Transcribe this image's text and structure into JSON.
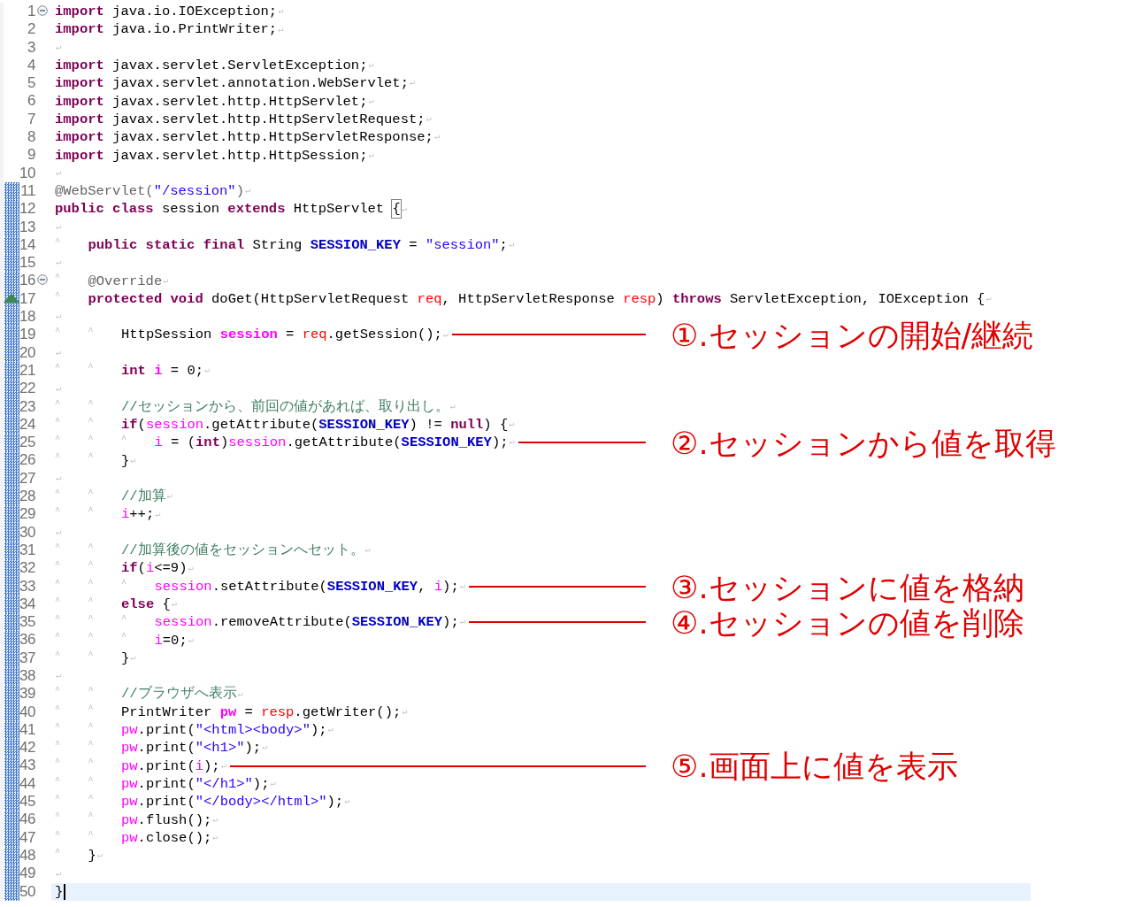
{
  "editor": {
    "lines": [
      {
        "number": "1",
        "collapsible": true,
        "overrides": false,
        "changed": false,
        "current": false,
        "tokens": [
          {
            "kind": "kw",
            "text": "import"
          },
          {
            "kind": "pl",
            "text": " java.io.IOException;"
          },
          {
            "kind": "eol",
            "text": "↵"
          }
        ]
      },
      {
        "number": "2",
        "collapsible": false,
        "overrides": false,
        "changed": false,
        "current": false,
        "tokens": [
          {
            "kind": "kw",
            "text": "import"
          },
          {
            "kind": "pl",
            "text": " java.io.PrintWriter;"
          },
          {
            "kind": "eol",
            "text": "↵"
          }
        ]
      },
      {
        "number": "3",
        "collapsible": false,
        "overrides": false,
        "changed": false,
        "current": false,
        "tokens": [
          {
            "kind": "eol",
            "text": "↵"
          }
        ]
      },
      {
        "number": "4",
        "collapsible": false,
        "overrides": false,
        "changed": false,
        "current": false,
        "tokens": [
          {
            "kind": "kw",
            "text": "import"
          },
          {
            "kind": "pl",
            "text": " javax.servlet.ServletException;"
          },
          {
            "kind": "eol",
            "text": "↵"
          }
        ]
      },
      {
        "number": "5",
        "collapsible": false,
        "overrides": false,
        "changed": false,
        "current": false,
        "tokens": [
          {
            "kind": "kw",
            "text": "import"
          },
          {
            "kind": "pl",
            "text": " javax.servlet.annotation.WebServlet;"
          },
          {
            "kind": "eol",
            "text": "↵"
          }
        ]
      },
      {
        "number": "6",
        "collapsible": false,
        "overrides": false,
        "changed": false,
        "current": false,
        "tokens": [
          {
            "kind": "kw",
            "text": "import"
          },
          {
            "kind": "pl",
            "text": " javax.servlet.http.HttpServlet;"
          },
          {
            "kind": "eol",
            "text": "↵"
          }
        ]
      },
      {
        "number": "7",
        "collapsible": false,
        "overrides": false,
        "changed": false,
        "current": false,
        "tokens": [
          {
            "kind": "kw",
            "text": "import"
          },
          {
            "kind": "pl",
            "text": " javax.servlet.http.HttpServletRequest;"
          },
          {
            "kind": "eol",
            "text": "↵"
          }
        ]
      },
      {
        "number": "8",
        "collapsible": false,
        "overrides": false,
        "changed": false,
        "current": false,
        "tokens": [
          {
            "kind": "kw",
            "text": "import"
          },
          {
            "kind": "pl",
            "text": " javax.servlet.http.HttpServletResponse;"
          },
          {
            "kind": "eol",
            "text": "↵"
          }
        ]
      },
      {
        "number": "9",
        "collapsible": false,
        "overrides": false,
        "changed": false,
        "current": false,
        "tokens": [
          {
            "kind": "kw",
            "text": "import"
          },
          {
            "kind": "pl",
            "text": " javax.servlet.http.HttpSession;"
          },
          {
            "kind": "eol",
            "text": "↵"
          }
        ]
      },
      {
        "number": "10",
        "collapsible": false,
        "overrides": false,
        "changed": false,
        "current": false,
        "tokens": [
          {
            "kind": "eol",
            "text": "↵"
          }
        ]
      },
      {
        "number": "11",
        "collapsible": false,
        "overrides": false,
        "changed": true,
        "current": false,
        "tokens": [
          {
            "kind": "anno",
            "text": "@WebServlet("
          },
          {
            "kind": "str",
            "text": "\"/session\""
          },
          {
            "kind": "anno",
            "text": ")"
          },
          {
            "kind": "eol",
            "text": "↵"
          }
        ]
      },
      {
        "number": "12",
        "collapsible": false,
        "overrides": false,
        "changed": true,
        "current": false,
        "tokens": [
          {
            "kind": "kw",
            "text": "public class"
          },
          {
            "kind": "pl",
            "text": " session "
          },
          {
            "kind": "kw",
            "text": "extends"
          },
          {
            "kind": "pl",
            "text": " HttpServlet "
          },
          {
            "kind": "match",
            "text": "{"
          },
          {
            "kind": "eol",
            "text": "↵"
          }
        ]
      },
      {
        "number": "13",
        "collapsible": false,
        "overrides": false,
        "changed": true,
        "current": false,
        "tokens": [
          {
            "kind": "eol",
            "text": "↵"
          }
        ]
      },
      {
        "number": "14",
        "collapsible": false,
        "overrides": false,
        "changed": true,
        "current": false,
        "tokens": [
          {
            "kind": "tab",
            "text": "^"
          },
          {
            "kind": "kw",
            "text": "public static final"
          },
          {
            "kind": "pl",
            "text": " String "
          },
          {
            "kind": "const",
            "text": "SESSION_KEY"
          },
          {
            "kind": "pl",
            "text": " = "
          },
          {
            "kind": "str",
            "text": "\"session\""
          },
          {
            "kind": "pl",
            "text": ";"
          },
          {
            "kind": "eol",
            "text": "↵"
          }
        ]
      },
      {
        "number": "15",
        "collapsible": false,
        "overrides": false,
        "changed": true,
        "current": false,
        "tokens": [
          {
            "kind": "eol",
            "text": "↵"
          }
        ]
      },
      {
        "number": "16",
        "collapsible": true,
        "overrides": false,
        "changed": true,
        "current": false,
        "tokens": [
          {
            "kind": "tab",
            "text": "^"
          },
          {
            "kind": "anno",
            "text": "@Override"
          },
          {
            "kind": "eol",
            "text": "↵"
          }
        ]
      },
      {
        "number": "17",
        "collapsible": false,
        "overrides": true,
        "changed": true,
        "current": false,
        "tokens": [
          {
            "kind": "tab",
            "text": "^"
          },
          {
            "kind": "kw",
            "text": "protected void"
          },
          {
            "kind": "pl",
            "text": " doGet(HttpServletRequest "
          },
          {
            "kind": "param",
            "text": "req"
          },
          {
            "kind": "pl",
            "text": ", HttpServletResponse "
          },
          {
            "kind": "param",
            "text": "resp"
          },
          {
            "kind": "pl",
            "text": ") "
          },
          {
            "kind": "kw",
            "text": "throws"
          },
          {
            "kind": "pl",
            "text": " ServletException, IOException {"
          },
          {
            "kind": "eol",
            "text": "↵"
          }
        ]
      },
      {
        "number": "18",
        "collapsible": false,
        "overrides": false,
        "changed": true,
        "current": false,
        "tokens": [
          {
            "kind": "eol",
            "text": "↵"
          }
        ]
      },
      {
        "number": "19",
        "collapsible": false,
        "overrides": false,
        "changed": true,
        "current": false,
        "note": "①.セッションの開始/継続",
        "tokens": [
          {
            "kind": "tab",
            "text": "^"
          },
          {
            "kind": "tab",
            "text": "^"
          },
          {
            "kind": "pl",
            "text": "HttpSession "
          },
          {
            "kind": "localb",
            "text": "session"
          },
          {
            "kind": "pl",
            "text": " = "
          },
          {
            "kind": "param",
            "text": "req"
          },
          {
            "kind": "pl",
            "text": ".getSession();"
          },
          {
            "kind": "eol",
            "text": "↵"
          }
        ]
      },
      {
        "number": "20",
        "collapsible": false,
        "overrides": false,
        "changed": true,
        "current": false,
        "tokens": [
          {
            "kind": "eol",
            "text": "↵"
          }
        ]
      },
      {
        "number": "21",
        "collapsible": false,
        "overrides": false,
        "changed": true,
        "current": false,
        "tokens": [
          {
            "kind": "tab",
            "text": "^"
          },
          {
            "kind": "tab",
            "text": "^"
          },
          {
            "kind": "kw",
            "text": "int "
          },
          {
            "kind": "localb",
            "text": "i"
          },
          {
            "kind": "pl",
            "text": " = 0;"
          },
          {
            "kind": "eol",
            "text": "↵"
          }
        ]
      },
      {
        "number": "22",
        "collapsible": false,
        "overrides": false,
        "changed": true,
        "current": false,
        "tokens": [
          {
            "kind": "eol",
            "text": "↵"
          }
        ]
      },
      {
        "number": "23",
        "collapsible": false,
        "overrides": false,
        "changed": true,
        "current": false,
        "tokens": [
          {
            "kind": "tab",
            "text": "^"
          },
          {
            "kind": "tab",
            "text": "^"
          },
          {
            "kind": "comment",
            "text": "//セッションから、前回の値があれば、取り出し。"
          },
          {
            "kind": "eol",
            "text": "↵"
          }
        ]
      },
      {
        "number": "24",
        "collapsible": false,
        "overrides": false,
        "changed": true,
        "current": false,
        "tokens": [
          {
            "kind": "tab",
            "text": "^"
          },
          {
            "kind": "tab",
            "text": "^"
          },
          {
            "kind": "kw",
            "text": "if"
          },
          {
            "kind": "pl",
            "text": "("
          },
          {
            "kind": "local",
            "text": "session"
          },
          {
            "kind": "pl",
            "text": ".getAttribute("
          },
          {
            "kind": "const",
            "text": "SESSION_KEY"
          },
          {
            "kind": "pl",
            "text": ") != "
          },
          {
            "kind": "kw",
            "text": "null"
          },
          {
            "kind": "pl",
            "text": ") {"
          },
          {
            "kind": "eol",
            "text": "↵"
          }
        ]
      },
      {
        "number": "25",
        "collapsible": false,
        "overrides": false,
        "changed": true,
        "current": false,
        "note": "②.セッションから値を取得",
        "tokens": [
          {
            "kind": "tab",
            "text": "^"
          },
          {
            "kind": "tab",
            "text": "^"
          },
          {
            "kind": "tab",
            "text": "^"
          },
          {
            "kind": "local",
            "text": "i"
          },
          {
            "kind": "pl",
            "text": " = ("
          },
          {
            "kind": "kw",
            "text": "int"
          },
          {
            "kind": "pl",
            "text": ")"
          },
          {
            "kind": "local",
            "text": "session"
          },
          {
            "kind": "pl",
            "text": ".getAttribute("
          },
          {
            "kind": "const",
            "text": "SESSION_KEY"
          },
          {
            "kind": "pl",
            "text": ");"
          },
          {
            "kind": "eol",
            "text": "↵"
          }
        ]
      },
      {
        "number": "26",
        "collapsible": false,
        "overrides": false,
        "changed": true,
        "current": false,
        "tokens": [
          {
            "kind": "tab",
            "text": "^"
          },
          {
            "kind": "tab",
            "text": "^"
          },
          {
            "kind": "pl",
            "text": "}"
          },
          {
            "kind": "eol",
            "text": "↵"
          }
        ]
      },
      {
        "number": "27",
        "collapsible": false,
        "overrides": false,
        "changed": true,
        "current": false,
        "tokens": [
          {
            "kind": "eol",
            "text": "↵"
          }
        ]
      },
      {
        "number": "28",
        "collapsible": false,
        "overrides": false,
        "changed": true,
        "current": false,
        "tokens": [
          {
            "kind": "tab",
            "text": "^"
          },
          {
            "kind": "tab",
            "text": "^"
          },
          {
            "kind": "comment",
            "text": "//加算"
          },
          {
            "kind": "eol",
            "text": "↵"
          }
        ]
      },
      {
        "number": "29",
        "collapsible": false,
        "overrides": false,
        "changed": true,
        "current": false,
        "tokens": [
          {
            "kind": "tab",
            "text": "^"
          },
          {
            "kind": "tab",
            "text": "^"
          },
          {
            "kind": "local",
            "text": "i"
          },
          {
            "kind": "pl",
            "text": "++;"
          },
          {
            "kind": "eol",
            "text": "↵"
          }
        ]
      },
      {
        "number": "30",
        "collapsible": false,
        "overrides": false,
        "changed": true,
        "current": false,
        "tokens": [
          {
            "kind": "eol",
            "text": "↵"
          }
        ]
      },
      {
        "number": "31",
        "collapsible": false,
        "overrides": false,
        "changed": true,
        "current": false,
        "tokens": [
          {
            "kind": "tab",
            "text": "^"
          },
          {
            "kind": "tab",
            "text": "^"
          },
          {
            "kind": "comment",
            "text": "//加算後の値をセッションへセット。"
          },
          {
            "kind": "eol",
            "text": "↵"
          }
        ]
      },
      {
        "number": "32",
        "collapsible": false,
        "overrides": false,
        "changed": true,
        "current": false,
        "tokens": [
          {
            "kind": "tab",
            "text": "^"
          },
          {
            "kind": "tab",
            "text": "^"
          },
          {
            "kind": "kw",
            "text": "if"
          },
          {
            "kind": "pl",
            "text": "("
          },
          {
            "kind": "local",
            "text": "i"
          },
          {
            "kind": "pl",
            "text": "<=9)"
          },
          {
            "kind": "eol",
            "text": "↵"
          }
        ]
      },
      {
        "number": "33",
        "collapsible": false,
        "overrides": false,
        "changed": true,
        "current": false,
        "note": "③.セッションに値を格納",
        "tokens": [
          {
            "kind": "tab",
            "text": "^"
          },
          {
            "kind": "tab",
            "text": "^"
          },
          {
            "kind": "tab",
            "text": "^"
          },
          {
            "kind": "local",
            "text": "session"
          },
          {
            "kind": "pl",
            "text": ".setAttribute("
          },
          {
            "kind": "const",
            "text": "SESSION_KEY"
          },
          {
            "kind": "pl",
            "text": ", "
          },
          {
            "kind": "local",
            "text": "i"
          },
          {
            "kind": "pl",
            "text": ");"
          },
          {
            "kind": "eol",
            "text": "↵"
          }
        ]
      },
      {
        "number": "34",
        "collapsible": false,
        "overrides": false,
        "changed": true,
        "current": false,
        "tokens": [
          {
            "kind": "tab",
            "text": "^"
          },
          {
            "kind": "tab",
            "text": "^"
          },
          {
            "kind": "kw",
            "text": "else"
          },
          {
            "kind": "pl",
            "text": " {"
          },
          {
            "kind": "eol",
            "text": "↵"
          }
        ]
      },
      {
        "number": "35",
        "collapsible": false,
        "overrides": false,
        "changed": true,
        "current": false,
        "note": "④.セッションの値を削除",
        "tokens": [
          {
            "kind": "tab",
            "text": "^"
          },
          {
            "kind": "tab",
            "text": "^"
          },
          {
            "kind": "tab",
            "text": "^"
          },
          {
            "kind": "local",
            "text": "session"
          },
          {
            "kind": "pl",
            "text": ".removeAttribute("
          },
          {
            "kind": "const",
            "text": "SESSION_KEY"
          },
          {
            "kind": "pl",
            "text": ");"
          },
          {
            "kind": "eol",
            "text": "↵"
          }
        ]
      },
      {
        "number": "36",
        "collapsible": false,
        "overrides": false,
        "changed": true,
        "current": false,
        "tokens": [
          {
            "kind": "tab",
            "text": "^"
          },
          {
            "kind": "tab",
            "text": "^"
          },
          {
            "kind": "tab",
            "text": "^"
          },
          {
            "kind": "local",
            "text": "i"
          },
          {
            "kind": "pl",
            "text": "=0;"
          },
          {
            "kind": "eol",
            "text": "↵"
          }
        ]
      },
      {
        "number": "37",
        "collapsible": false,
        "overrides": false,
        "changed": true,
        "current": false,
        "tokens": [
          {
            "kind": "tab",
            "text": "^"
          },
          {
            "kind": "tab",
            "text": "^"
          },
          {
            "kind": "pl",
            "text": "}"
          },
          {
            "kind": "eol",
            "text": "↵"
          }
        ]
      },
      {
        "number": "38",
        "collapsible": false,
        "overrides": false,
        "changed": true,
        "current": false,
        "tokens": [
          {
            "kind": "eol",
            "text": "↵"
          }
        ]
      },
      {
        "number": "39",
        "collapsible": false,
        "overrides": false,
        "changed": true,
        "current": false,
        "tokens": [
          {
            "kind": "tab",
            "text": "^"
          },
          {
            "kind": "tab",
            "text": "^"
          },
          {
            "kind": "comment",
            "text": "//ブラウザへ表示"
          },
          {
            "kind": "eol",
            "text": "↵"
          }
        ]
      },
      {
        "number": "40",
        "collapsible": false,
        "overrides": false,
        "changed": true,
        "current": false,
        "tokens": [
          {
            "kind": "tab",
            "text": "^"
          },
          {
            "kind": "tab",
            "text": "^"
          },
          {
            "kind": "pl",
            "text": "PrintWriter "
          },
          {
            "kind": "localb",
            "text": "pw"
          },
          {
            "kind": "pl",
            "text": " = "
          },
          {
            "kind": "param",
            "text": "resp"
          },
          {
            "kind": "pl",
            "text": ".getWriter();"
          },
          {
            "kind": "eol",
            "text": "↵"
          }
        ]
      },
      {
        "number": "41",
        "collapsible": false,
        "overrides": false,
        "changed": true,
        "current": false,
        "tokens": [
          {
            "kind": "tab",
            "text": "^"
          },
          {
            "kind": "tab",
            "text": "^"
          },
          {
            "kind": "local",
            "text": "pw"
          },
          {
            "kind": "pl",
            "text": ".print("
          },
          {
            "kind": "str",
            "text": "\"<html><body>\""
          },
          {
            "kind": "pl",
            "text": ");"
          },
          {
            "kind": "eol",
            "text": "↵"
          }
        ]
      },
      {
        "number": "42",
        "collapsible": false,
        "overrides": false,
        "changed": true,
        "current": false,
        "tokens": [
          {
            "kind": "tab",
            "text": "^"
          },
          {
            "kind": "tab",
            "text": "^"
          },
          {
            "kind": "local",
            "text": "pw"
          },
          {
            "kind": "pl",
            "text": ".print("
          },
          {
            "kind": "str",
            "text": "\"<h1>\""
          },
          {
            "kind": "pl",
            "text": ");"
          },
          {
            "kind": "eol",
            "text": "↵"
          }
        ]
      },
      {
        "number": "43",
        "collapsible": false,
        "overrides": false,
        "changed": true,
        "current": false,
        "note": "⑤.画面上に値を表示",
        "tokens": [
          {
            "kind": "tab",
            "text": "^"
          },
          {
            "kind": "tab",
            "text": "^"
          },
          {
            "kind": "local",
            "text": "pw"
          },
          {
            "kind": "pl",
            "text": ".print("
          },
          {
            "kind": "local",
            "text": "i"
          },
          {
            "kind": "pl",
            "text": ");"
          },
          {
            "kind": "eol",
            "text": "↵"
          }
        ]
      },
      {
        "number": "44",
        "collapsible": false,
        "overrides": false,
        "changed": true,
        "current": false,
        "tokens": [
          {
            "kind": "tab",
            "text": "^"
          },
          {
            "kind": "tab",
            "text": "^"
          },
          {
            "kind": "local",
            "text": "pw"
          },
          {
            "kind": "pl",
            "text": ".print("
          },
          {
            "kind": "str",
            "text": "\"</h1>\""
          },
          {
            "kind": "pl",
            "text": ");"
          },
          {
            "kind": "eol",
            "text": "↵"
          }
        ]
      },
      {
        "number": "45",
        "collapsible": false,
        "overrides": false,
        "changed": true,
        "current": false,
        "tokens": [
          {
            "kind": "tab",
            "text": "^"
          },
          {
            "kind": "tab",
            "text": "^"
          },
          {
            "kind": "local",
            "text": "pw"
          },
          {
            "kind": "pl",
            "text": ".print("
          },
          {
            "kind": "str",
            "text": "\"</body></html>\""
          },
          {
            "kind": "pl",
            "text": ");"
          },
          {
            "kind": "eol",
            "text": "↵"
          }
        ]
      },
      {
        "number": "46",
        "collapsible": false,
        "overrides": false,
        "changed": true,
        "current": false,
        "tokens": [
          {
            "kind": "tab",
            "text": "^"
          },
          {
            "kind": "tab",
            "text": "^"
          },
          {
            "kind": "local",
            "text": "pw"
          },
          {
            "kind": "pl",
            "text": ".flush();"
          },
          {
            "kind": "eol",
            "text": "↵"
          }
        ]
      },
      {
        "number": "47",
        "collapsible": false,
        "overrides": false,
        "changed": true,
        "current": false,
        "tokens": [
          {
            "kind": "tab",
            "text": "^"
          },
          {
            "kind": "tab",
            "text": "^"
          },
          {
            "kind": "local",
            "text": "pw"
          },
          {
            "kind": "pl",
            "text": ".close();"
          },
          {
            "kind": "eol",
            "text": "↵"
          }
        ]
      },
      {
        "number": "48",
        "collapsible": false,
        "overrides": false,
        "changed": true,
        "current": false,
        "tokens": [
          {
            "kind": "tab",
            "text": "^"
          },
          {
            "kind": "pl",
            "text": "}"
          },
          {
            "kind": "eol",
            "text": "↵"
          }
        ]
      },
      {
        "number": "49",
        "collapsible": false,
        "overrides": false,
        "changed": true,
        "current": false,
        "tokens": [
          {
            "kind": "eol",
            "text": "↵"
          }
        ]
      },
      {
        "number": "50",
        "collapsible": false,
        "overrides": false,
        "changed": true,
        "current": true,
        "tokens": [
          {
            "kind": "pl",
            "text": "}"
          }
        ]
      }
    ]
  }
}
